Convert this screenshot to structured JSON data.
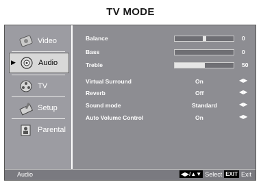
{
  "title": "TV MODE",
  "sidebar": {
    "items": [
      {
        "label": "Video",
        "icon": "video-icon"
      },
      {
        "label": "Audio",
        "icon": "audio-icon"
      },
      {
        "label": "TV",
        "icon": "tv-icon"
      },
      {
        "label": "Setup",
        "icon": "setup-icon"
      },
      {
        "label": "Parental",
        "icon": "parental-icon"
      }
    ],
    "active": "Audio"
  },
  "audio": {
    "balance": {
      "label": "Balance",
      "value": "0",
      "level": 0.5
    },
    "bass": {
      "label": "Bass",
      "value": "0",
      "level": 0.5
    },
    "treble": {
      "label": "Treble",
      "value": "50",
      "level": 0.5
    },
    "virtual_surround": {
      "label": "Virtual Surround",
      "value": "On"
    },
    "reverb": {
      "label": "Reverb",
      "value": "Off"
    },
    "sound_mode": {
      "label": "Sound mode",
      "value": "Standard"
    },
    "avc": {
      "label": "Auto Volume Control",
      "value": "On"
    }
  },
  "status_bar": {
    "section": "Audio",
    "nav_hint": "◀▶/▲▼",
    "select_label": "Select",
    "exit_key": "EXIT",
    "exit_label": "Exit"
  }
}
